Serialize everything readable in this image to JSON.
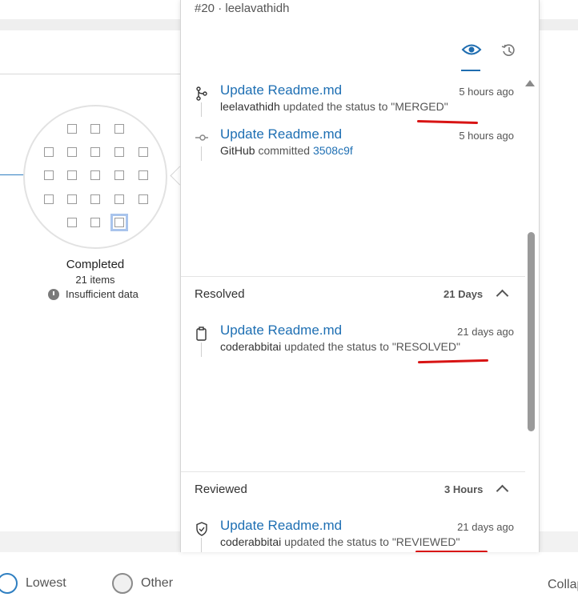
{
  "stage": {
    "title": "Completed",
    "count": "21 items",
    "note": "Insufficient data"
  },
  "legend": {
    "lowest": "Lowest",
    "other": "Other",
    "collapse": "Collap"
  },
  "panel": {
    "subtitle": "#20 · leelavathidh",
    "tabs": [
      {
        "name": "eye-icon",
        "active": true
      },
      {
        "name": "history-icon",
        "active": false
      }
    ],
    "top_entries": [
      {
        "icon": "merge-icon",
        "title": "Update Readme.md",
        "time": "5 hours ago",
        "actor": "leelavathidh",
        "text": " updated the status to ",
        "value": "\"MERGED\""
      },
      {
        "icon": "commit-icon",
        "title": "Update Readme.md",
        "time": "5 hours ago",
        "actor": "GitHub",
        "text": " committed ",
        "value": "3508c9f"
      }
    ],
    "sections": [
      {
        "label": "Resolved",
        "duration": "21 Days",
        "entry": {
          "icon": "clipboard-icon",
          "title": "Update Readme.md",
          "time": "21 days ago",
          "actor": "coderabbitai",
          "text": " updated the status to ",
          "value": "\"RESOLVED\""
        }
      },
      {
        "label": "Reviewed",
        "duration": "3 Hours",
        "entry": {
          "icon": "shield-icon",
          "title": "Update Readme.md",
          "time": "21 days ago",
          "actor": "coderabbitai",
          "text": " updated the status to ",
          "value": "\"REVIEWED\""
        }
      }
    ]
  },
  "colors": {
    "accent": "#1e6fb3",
    "annotation": "#d81414"
  }
}
